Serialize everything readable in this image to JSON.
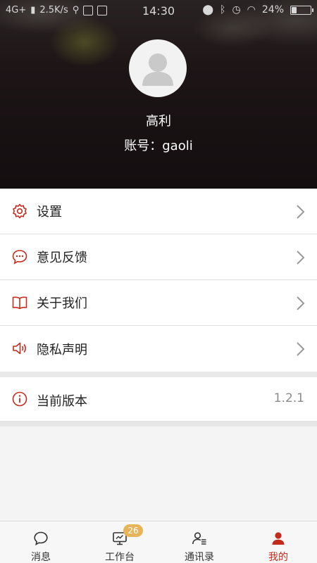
{
  "status_bar": {
    "network": "4G+",
    "speed": "2.5K/s",
    "time": "14:30",
    "battery": "24%",
    "battery_level": 0.24
  },
  "profile": {
    "name": "高利",
    "account": "账号：gaoli"
  },
  "menu": {
    "items": [
      {
        "label": "设置",
        "icon": "gear-icon"
      },
      {
        "label": "意见反馈",
        "icon": "chat-icon"
      },
      {
        "label": "关于我们",
        "icon": "book-icon"
      },
      {
        "label": "隐私声明",
        "icon": "speaker-icon"
      }
    ]
  },
  "version": {
    "label": "当前版本",
    "value": "1.2.1",
    "icon": "info-icon"
  },
  "tabbar": {
    "tabs": [
      {
        "label": "消息",
        "icon": "message-icon"
      },
      {
        "label": "工作台",
        "icon": "monitor-icon",
        "badge": "26"
      },
      {
        "label": "通讯录",
        "icon": "contacts-icon"
      },
      {
        "label": "我的",
        "icon": "user-icon",
        "active": true
      }
    ]
  },
  "colors": {
    "accent": "#c42b1c",
    "badge": "#e8b45a"
  }
}
